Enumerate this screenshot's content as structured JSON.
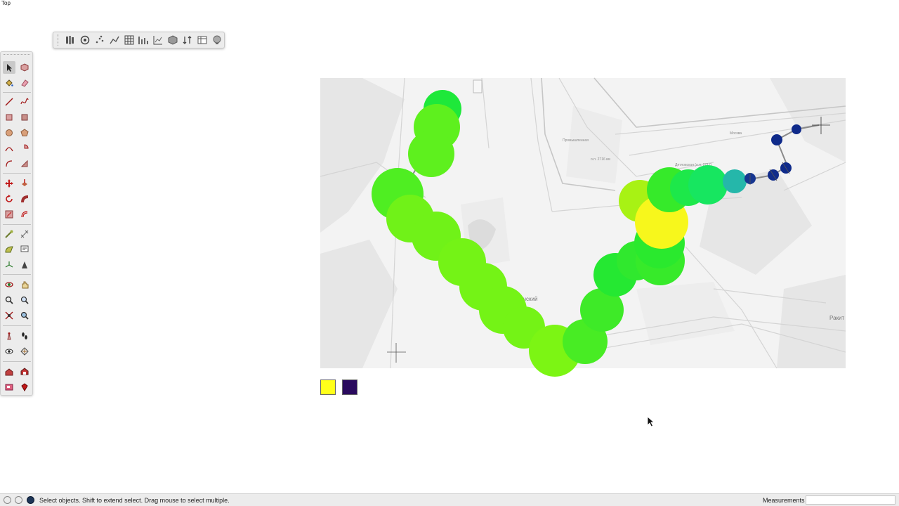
{
  "view": {
    "label": "Top"
  },
  "map": {
    "labels": [
      {
        "text": "Ленинский",
        "size": "big"
      },
      {
        "text": "Ракит",
        "size": "big"
      },
      {
        "text": "Москва",
        "size": "small"
      },
      {
        "text": "Дятловская (о.п. 2717)",
        "size": "small"
      },
      {
        "text": "о.п. 2716 км",
        "size": "small"
      },
      {
        "text": "Промышленная",
        "size": "small"
      }
    ]
  },
  "legend": {
    "colors": [
      "#ffff1a",
      "#2a0a5e"
    ]
  },
  "colors": {
    "yellow": "#f7f71c",
    "lime": "#7cf514",
    "green": "#1ee83a",
    "teal": "#25b7aa",
    "navy": "#0f2a8a"
  },
  "icons": {
    "toolbar": [
      "layers-icon",
      "globe-icon",
      "scatter-icon",
      "route-icon",
      "grid-icon",
      "stats-icon",
      "chart-icon",
      "box-icon",
      "sort-icon",
      "table-icon",
      "globe-settings-icon"
    ],
    "palette": [
      "select-arrow-icon",
      "component-icon",
      "paint-bucket-icon",
      "eraser-icon",
      "line-icon",
      "freehand-icon",
      "rectangle-icon",
      "rotated-rectangle-icon",
      "circle-icon",
      "polygon-icon",
      "arc-icon",
      "pie-icon",
      "two-point-arc-icon",
      "three-point-arc-icon",
      "move-icon",
      "push-pull-icon",
      "rotate-icon",
      "follow-me-icon",
      "scale-icon",
      "offset-icon",
      "tape-measure-icon",
      "dimension-icon",
      "protractor-icon",
      "text-icon",
      "axes-icon",
      "3d-text-icon",
      "orbit-icon",
      "pan-icon",
      "zoom-icon",
      "zoom-window-icon",
      "zoom-extents-icon",
      "previous-view-icon",
      "position-camera-icon",
      "walk-icon",
      "look-around-icon",
      "section-plane-icon",
      "warehouse-icon",
      "extension-warehouse-icon",
      "layout-icon",
      "ruby-icon"
    ]
  },
  "status": {
    "message": "Select objects. Shift to extend select. Drag mouse to select multiple.",
    "measurements_label": "Measurements",
    "measurements_value": ""
  }
}
